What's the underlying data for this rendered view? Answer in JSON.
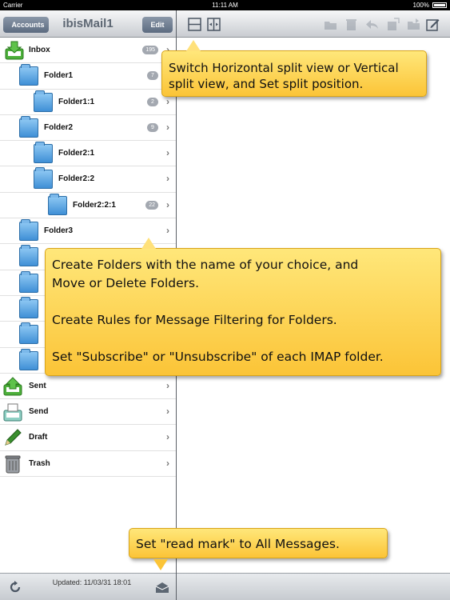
{
  "status_bar": {
    "carrier": "Carrier",
    "time": "11:11 AM",
    "battery": "100%"
  },
  "left_nav": {
    "back_label": "Accounts",
    "title": "ibisMail1",
    "edit_label": "Edit"
  },
  "folders": [
    {
      "label": "Inbox",
      "badge": "195",
      "icon": "inbox-icon"
    },
    {
      "label": "Folder1",
      "badge": "7",
      "icon": "folder-icon"
    },
    {
      "label": "Folder1:1",
      "badge": "2",
      "icon": "folder-icon"
    },
    {
      "label": "Folder2",
      "badge": "9",
      "icon": "folder-icon"
    },
    {
      "label": "Folder2:1",
      "badge": "",
      "icon": "folder-icon"
    },
    {
      "label": "Folder2:2",
      "badge": "",
      "icon": "folder-icon"
    },
    {
      "label": "Folder2:2:1",
      "badge": "22",
      "icon": "folder-icon"
    },
    {
      "label": "Folder3",
      "badge": "",
      "icon": "folder-icon"
    },
    {
      "label": "",
      "badge": "",
      "icon": "folder-icon"
    },
    {
      "label": "",
      "badge": "",
      "icon": "folder-icon"
    },
    {
      "label": "",
      "badge": "",
      "icon": "folder-icon"
    },
    {
      "label": "",
      "badge": "",
      "icon": "folder-icon"
    },
    {
      "label": "",
      "badge": "",
      "icon": "folder-icon"
    },
    {
      "label": "Sent",
      "badge": "",
      "icon": "sent-icon"
    },
    {
      "label": "Send",
      "badge": "",
      "icon": "outbox-icon"
    },
    {
      "label": "Draft",
      "badge": "",
      "icon": "pencil-icon"
    },
    {
      "label": "Trash",
      "badge": "",
      "icon": "trash-icon"
    }
  ],
  "bottom_bar": {
    "updated_text": "Updated: 11/03/31 18:01"
  },
  "callouts": {
    "split": "Switch  Horizontal split view or Vertical\nsplit view, and Set split position.",
    "folders": "Create Folders with the name of your choice, and\nMove or Delete Folders.\n\nCreate Rules for Message Filtering for Folders.\n\nSet \"Subscribe\" or \"Unsubscribe\" of each IMAP folder.",
    "read_mark": "Set \"read mark\" to All Messages."
  },
  "colors": {
    "callout": "#fbd24a",
    "toolbar_button": "#6d7b8f",
    "folder_blue": "#5aa7e6"
  }
}
